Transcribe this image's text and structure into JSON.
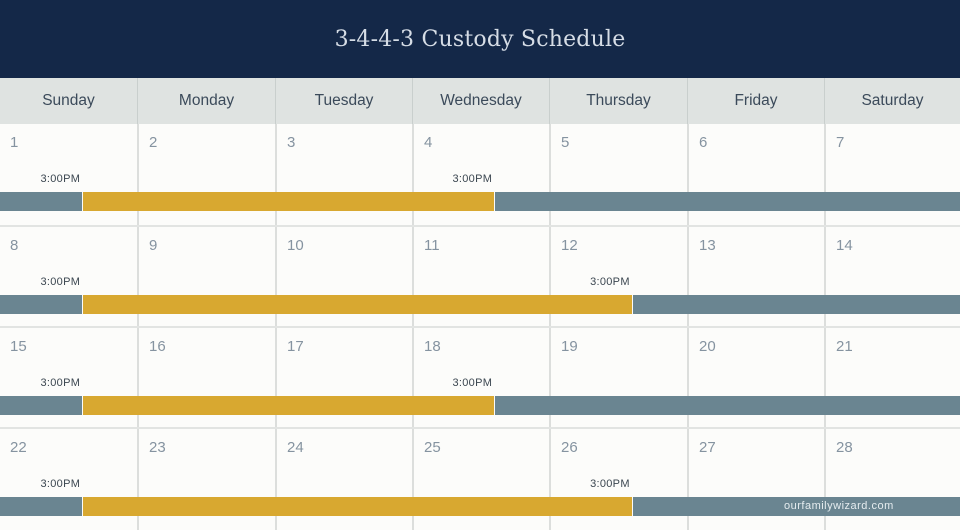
{
  "title": "3-4-4-3 Custody Schedule",
  "days": [
    "Sunday",
    "Monday",
    "Tuesday",
    "Wednesday",
    "Thursday",
    "Friday",
    "Saturday"
  ],
  "colors": {
    "header_bg": "#142848",
    "parent_a": "#6a8591",
    "parent_b": "#d8a830",
    "day_header_bg": "#dfe3e1"
  },
  "legend": {
    "parent_a_color_name": "slate",
    "parent_b_color_name": "gold"
  },
  "weeks": [
    {
      "dates": [
        "1",
        "2",
        "3",
        "4",
        "5",
        "6",
        "7"
      ],
      "exchanges": [
        {
          "day_index": 0,
          "time": "3:00PM"
        },
        {
          "day_index": 3,
          "time": "3:00PM"
        }
      ],
      "segments": [
        {
          "parent": "A",
          "from_day": 0,
          "to_day": 0.6
        },
        {
          "parent": "B",
          "from_day": 0.6,
          "to_day": 3.6
        },
        {
          "parent": "A",
          "from_day": 3.6,
          "to_day": 7
        }
      ]
    },
    {
      "dates": [
        "8",
        "9",
        "10",
        "11",
        "12",
        "13",
        "14"
      ],
      "exchanges": [
        {
          "day_index": 0,
          "time": "3:00PM"
        },
        {
          "day_index": 4,
          "time": "3:00PM"
        }
      ],
      "segments": [
        {
          "parent": "A",
          "from_day": 0,
          "to_day": 0.6
        },
        {
          "parent": "B",
          "from_day": 0.6,
          "to_day": 4.6
        },
        {
          "parent": "A",
          "from_day": 4.6,
          "to_day": 7
        }
      ]
    },
    {
      "dates": [
        "15",
        "16",
        "17",
        "18",
        "19",
        "20",
        "21"
      ],
      "exchanges": [
        {
          "day_index": 0,
          "time": "3:00PM"
        },
        {
          "day_index": 3,
          "time": "3:00PM"
        }
      ],
      "segments": [
        {
          "parent": "A",
          "from_day": 0,
          "to_day": 0.6
        },
        {
          "parent": "B",
          "from_day": 0.6,
          "to_day": 3.6
        },
        {
          "parent": "A",
          "from_day": 3.6,
          "to_day": 7
        }
      ]
    },
    {
      "dates": [
        "22",
        "23",
        "24",
        "25",
        "26",
        "27",
        "28"
      ],
      "exchanges": [
        {
          "day_index": 0,
          "time": "3:00PM"
        },
        {
          "day_index": 4,
          "time": "3:00PM"
        }
      ],
      "segments": [
        {
          "parent": "A",
          "from_day": 0,
          "to_day": 0.6
        },
        {
          "parent": "B",
          "from_day": 0.6,
          "to_day": 4.6
        },
        {
          "parent": "A",
          "from_day": 4.6,
          "to_day": 7
        }
      ]
    }
  ],
  "watermark": "ourfamilywizard.com"
}
